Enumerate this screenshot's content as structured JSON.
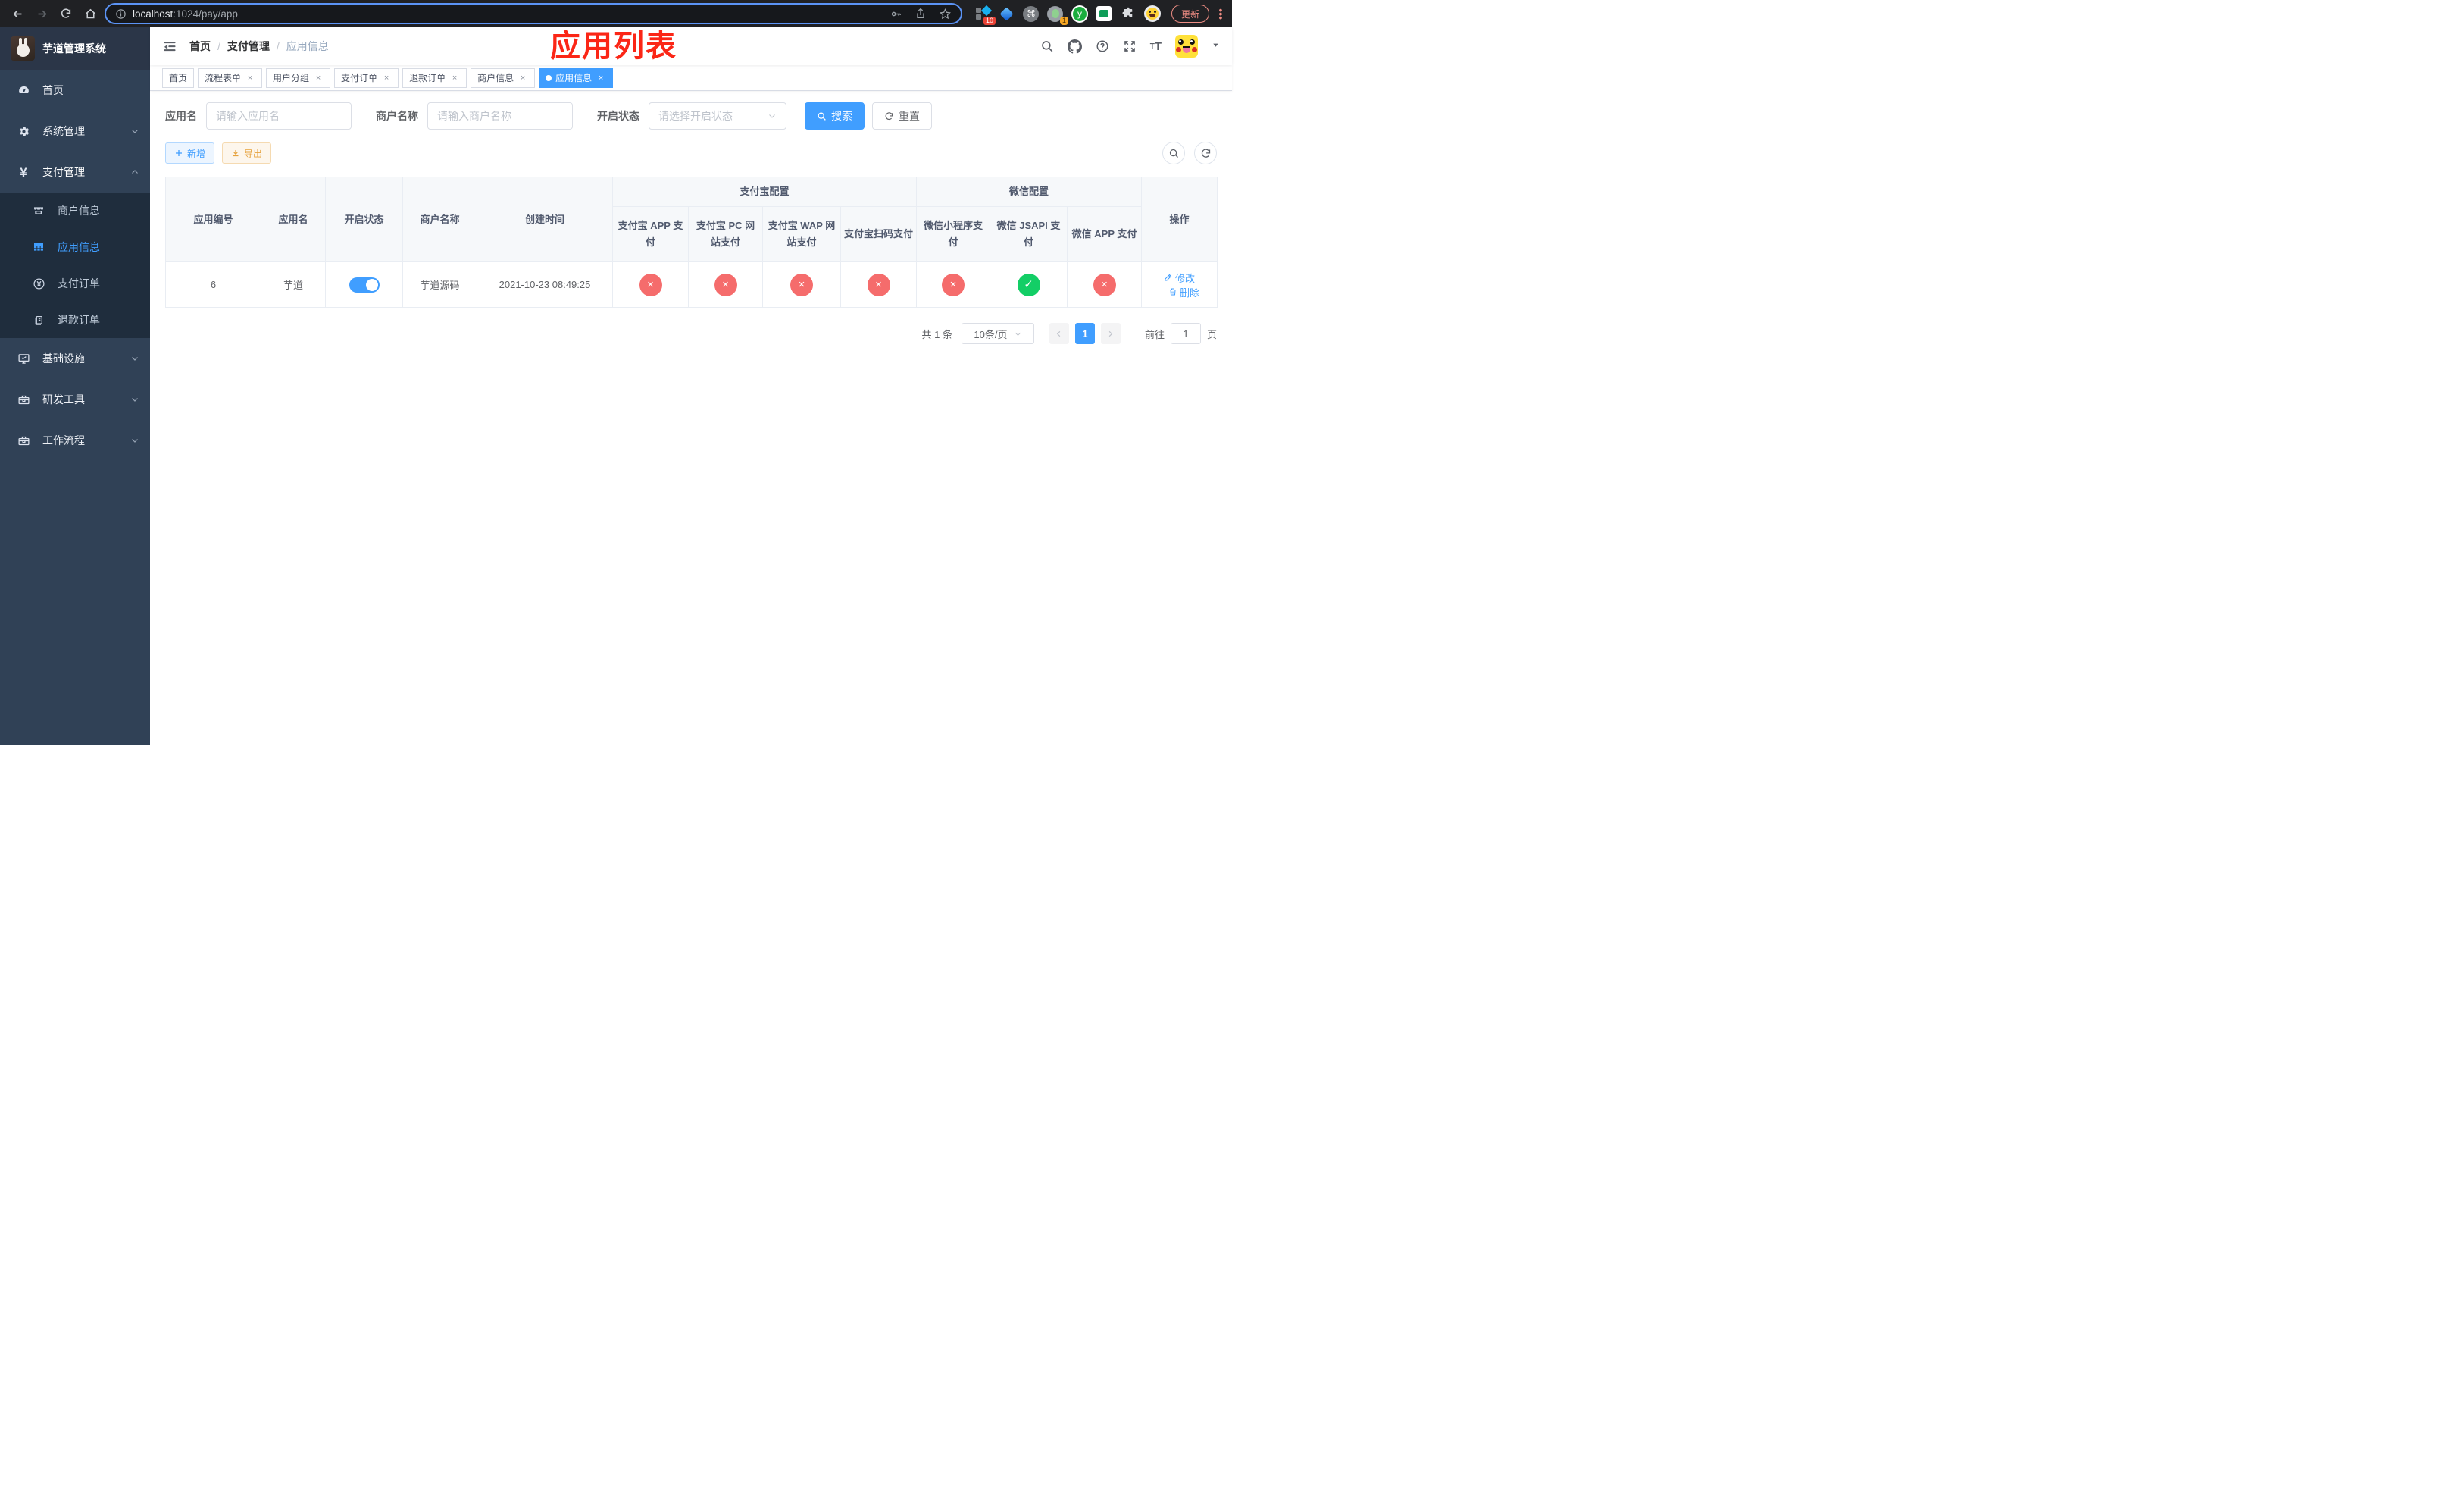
{
  "browser": {
    "url_host": "localhost",
    "url_path": ":1024/pay/app",
    "update_button": "更新",
    "ext_badge_10": "10",
    "ext_badge_1": "1",
    "ext_y_label": "y"
  },
  "sidebar": {
    "title": "芋道管理系统",
    "items": {
      "home": "首页",
      "system": "系统管理",
      "pay": "支付管理",
      "merchant": "商户信息",
      "appinfo": "应用信息",
      "payorder": "支付订单",
      "refund": "退款订单",
      "infra": "基础设施",
      "devtool": "研发工具",
      "workflow": "工作流程"
    }
  },
  "navbar": {
    "breadcrumb": {
      "home": "首页",
      "sep1": "/",
      "level1": "支付管理",
      "sep2": "/",
      "current": "应用信息"
    },
    "annotation": "应用列表"
  },
  "tabs": {
    "t0": "首页",
    "t1": "流程表单",
    "t2": "用户分组",
    "t3": "支付订单",
    "t4": "退款订单",
    "t5": "商户信息",
    "t6": "应用信息",
    "close": "×"
  },
  "filters": {
    "app_name_label": "应用名",
    "app_name_placeholder": "请输入应用名",
    "merchant_label": "商户名称",
    "merchant_placeholder": "请输入商户名称",
    "status_label": "开启状态",
    "status_placeholder": "请选择开启状态",
    "search": "搜索",
    "reset": "重置"
  },
  "toolbar": {
    "add": "新增",
    "export": "导出"
  },
  "table": {
    "group_alipay": "支付宝配置",
    "group_wechat": "微信配置",
    "col_app_id": "应用编号",
    "col_app_name": "应用名",
    "col_status": "开启状态",
    "col_merchant": "商户名称",
    "col_created": "创建时间",
    "col_alipay_app": "支付宝 APP 支付",
    "col_alipay_pc": "支付宝 PC 网站支付",
    "col_alipay_wap": "支付宝 WAP 网站支付",
    "col_alipay_scan": "支付宝扫码支付",
    "col_wx_lite": "微信小程序支付",
    "col_wx_jsapi": "微信 JSAPI 支付",
    "col_wx_app": "微信 APP 支付",
    "col_actions": "操作",
    "row": {
      "app_id": "6",
      "app_name": "芋道",
      "merchant": "芋道源码",
      "created": "2021-10-23 08:49:25",
      "statuses": [
        {
          "glyph": "×",
          "class": "status-dot fail"
        },
        {
          "glyph": "×",
          "class": "status-dot fail"
        },
        {
          "glyph": "×",
          "class": "status-dot fail"
        },
        {
          "glyph": "×",
          "class": "status-dot fail"
        },
        {
          "glyph": "×",
          "class": "status-dot fail"
        },
        {
          "glyph": "✓",
          "class": "status-dot success"
        },
        {
          "glyph": "×",
          "class": "status-dot fail"
        }
      ],
      "edit": "修改",
      "delete": "删除"
    }
  },
  "pagination": {
    "total": "共 1 条",
    "size": "10条/页",
    "page": "1",
    "goto_label": "前往",
    "goto_value": "1",
    "unit": "页"
  },
  "colors": {
    "accent": "#409eff",
    "fail": "#f56c6c",
    "success": "#13ce66",
    "annotation": "#fb2616"
  }
}
